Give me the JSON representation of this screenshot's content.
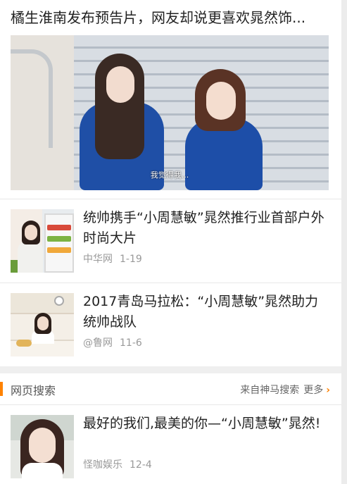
{
  "hero": {
    "title": "橘生淮南发布预告片，网友却说更喜欢晁然饰...",
    "subtitle": "我觉得我..."
  },
  "news": [
    {
      "title": "统帅携手“小周慧敏”晁然推行业首部户外时尚大片",
      "source": "中华网",
      "date": "1-19"
    },
    {
      "title": "2017青岛马拉松：“小周慧敏”晁然助力统帅战队",
      "source": "@鲁网",
      "date": "11-6"
    }
  ],
  "web_search": {
    "title": "网页搜索",
    "source_label": "来自神马搜索",
    "more_label": "更多",
    "chevron_icon": "chevron-right-icon",
    "accent_color": "#ff8200",
    "items": [
      {
        "title": "最好的我们,最美的你—“小周慧敏”晁然!",
        "source": "怪咖娱乐",
        "date": "12-4"
      }
    ]
  }
}
